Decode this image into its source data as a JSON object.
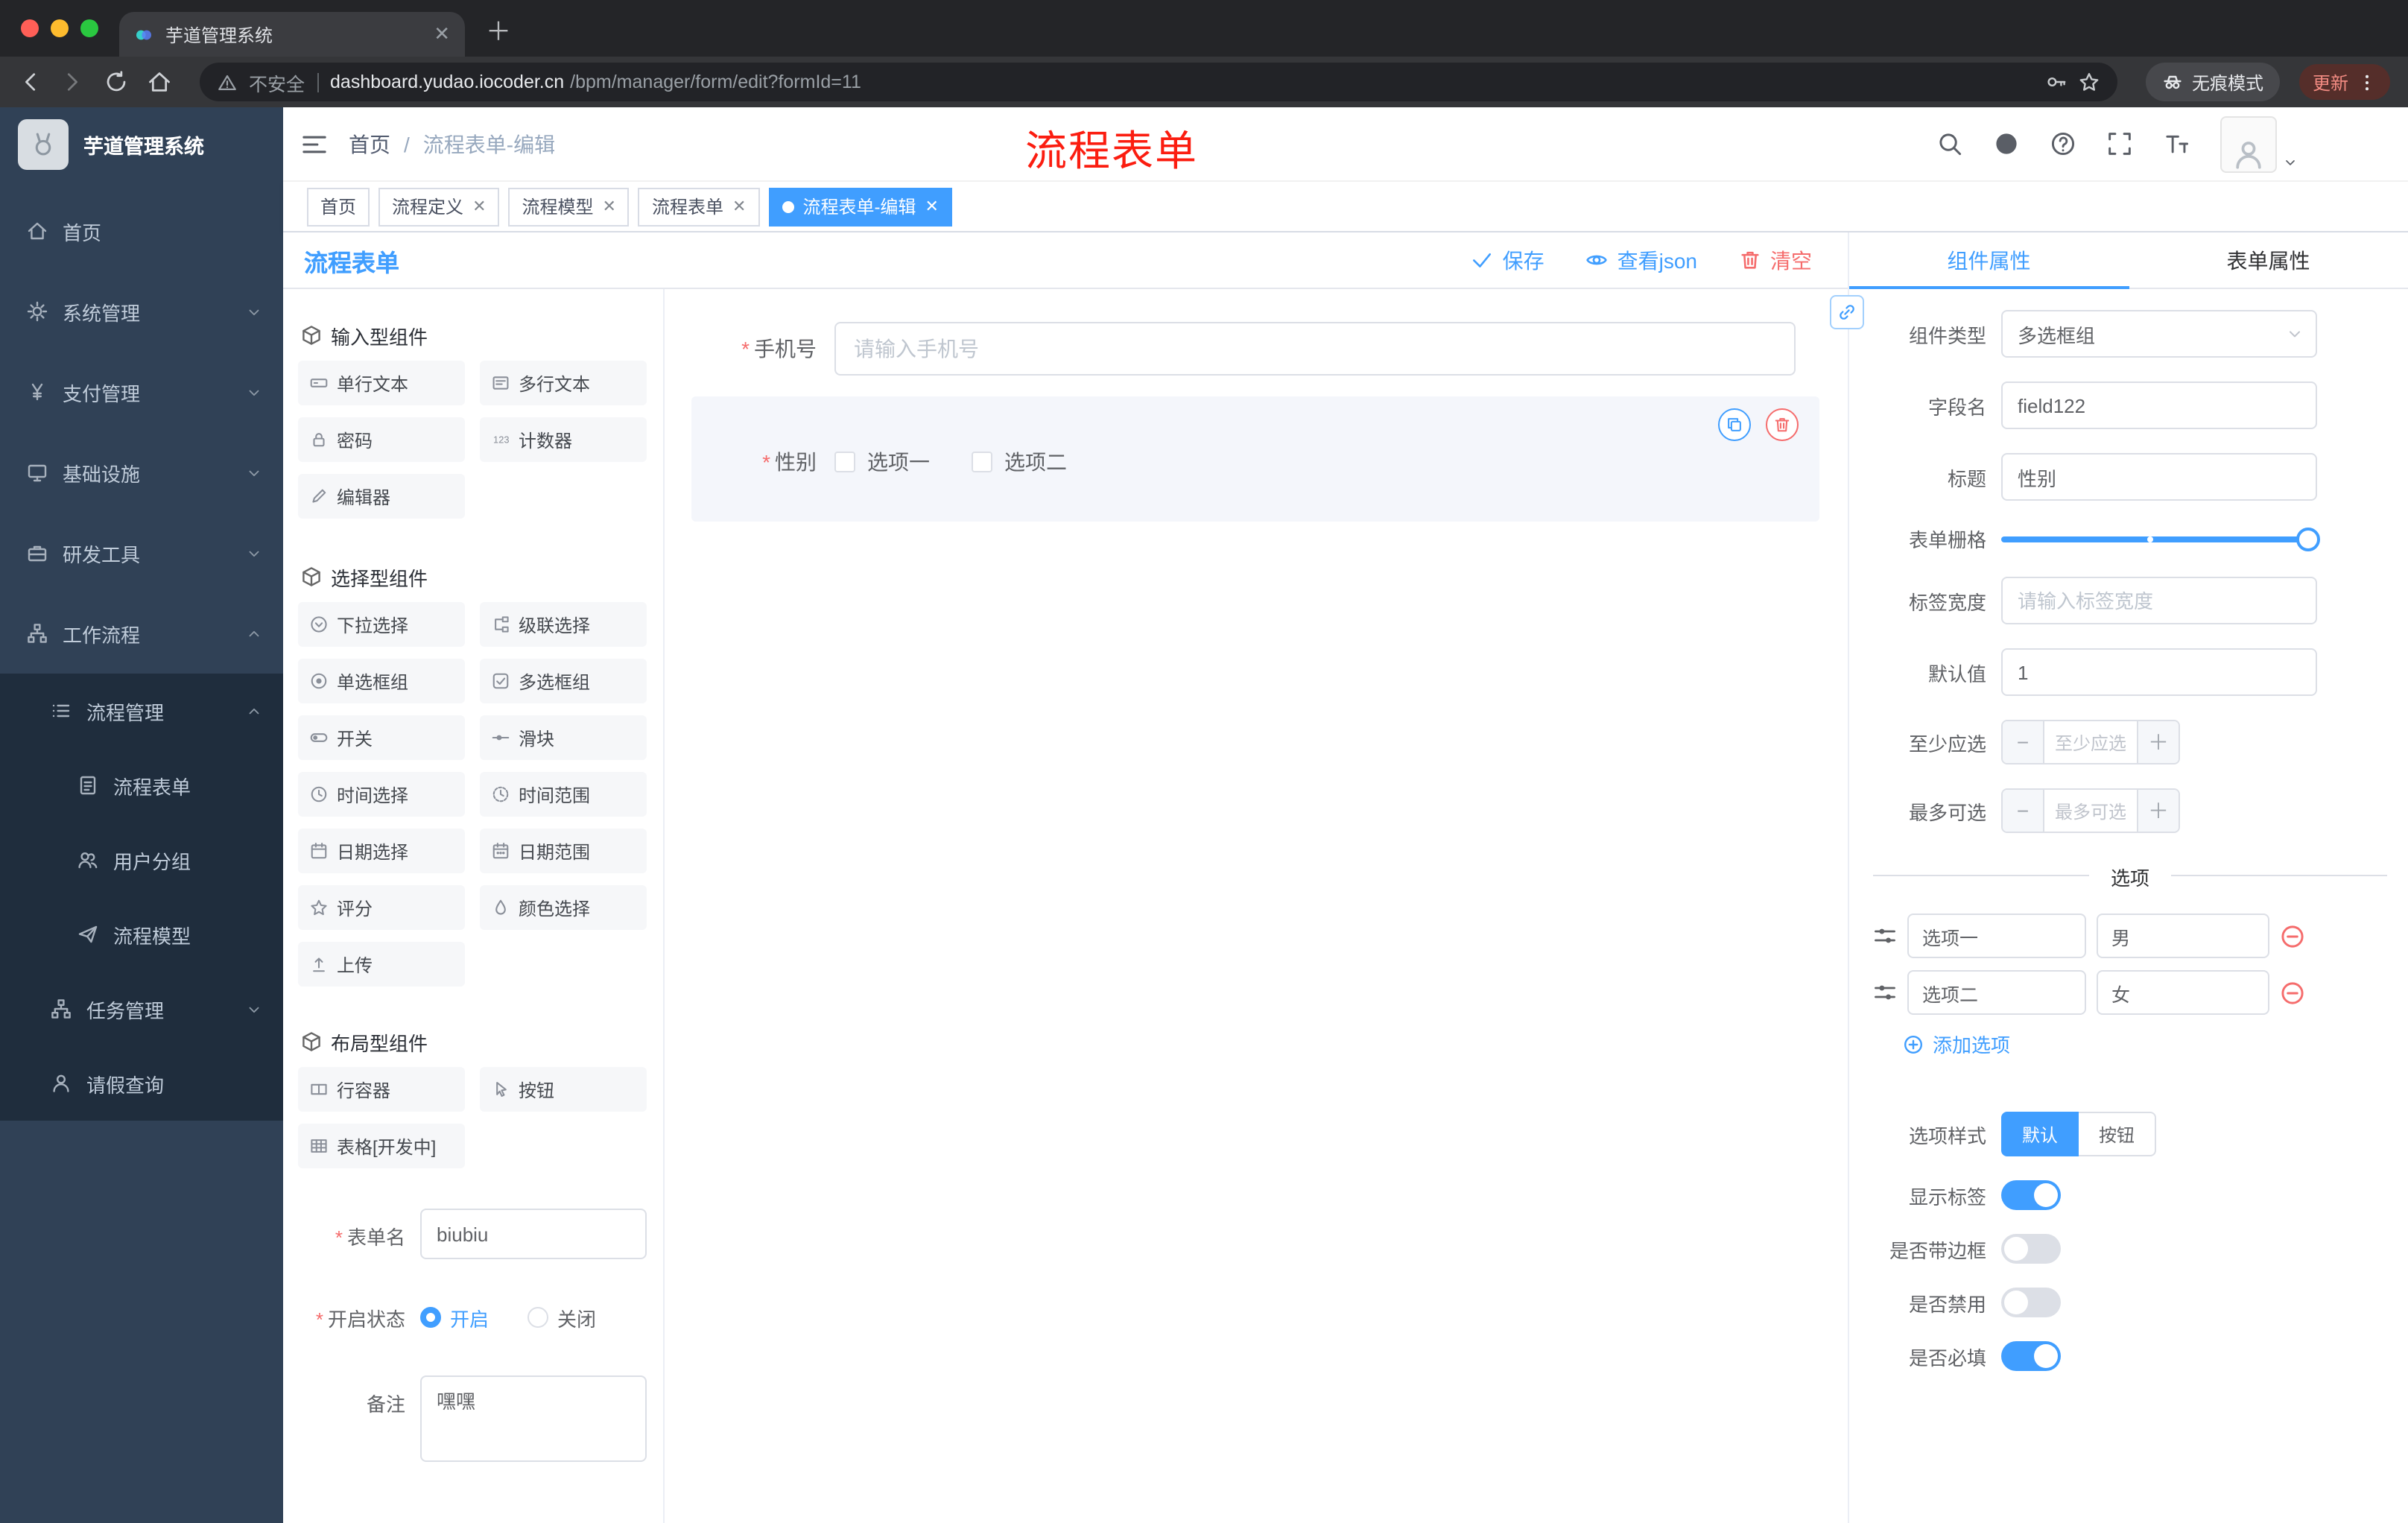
{
  "browser": {
    "tab_title": "芋道管理系统",
    "security_label": "不安全",
    "url_domain": "dashboard.yudao.iocoder.cn",
    "url_path": "/bpm/manager/form/edit?formId=11",
    "incognito_label": "无痕模式",
    "update_label": "更新"
  },
  "annotation": {
    "text": "流程表单"
  },
  "colors": {
    "accent": "#409eff",
    "danger": "#f56c6c",
    "sidebar_bg": "#304156",
    "sidebar_sub_bg": "#1f2d3d"
  },
  "sidebar": {
    "logo_title": "芋道管理系统",
    "menu": [
      {
        "label": "首页",
        "icon": "home-icon"
      },
      {
        "label": "系统管理",
        "icon": "gear-icon"
      },
      {
        "label": "支付管理",
        "icon": "yen-icon"
      },
      {
        "label": "基础设施",
        "icon": "infra-icon"
      },
      {
        "label": "研发工具",
        "icon": "tools-icon"
      },
      {
        "label": "工作流程",
        "icon": "workflow-icon"
      },
      {
        "label": "流程管理",
        "icon": "list-icon"
      },
      {
        "label": "流程表单",
        "icon": "document-icon"
      },
      {
        "label": "用户分组",
        "icon": "users-icon"
      },
      {
        "label": "流程模型",
        "icon": "paper-plane-icon"
      },
      {
        "label": "任务管理",
        "icon": "tree-icon"
      },
      {
        "label": "请假查询",
        "icon": "person-icon"
      }
    ]
  },
  "header": {
    "breadcrumb_home": "首页",
    "breadcrumb_sep": "/",
    "breadcrumb_current": "流程表单-编辑"
  },
  "tags": [
    {
      "label": "首页"
    },
    {
      "label": "流程定义"
    },
    {
      "label": "流程模型"
    },
    {
      "label": "流程表单"
    },
    {
      "label": "流程表单-编辑"
    }
  ],
  "palette": {
    "panel_title": "流程表单",
    "sections": [
      {
        "title": "输入型组件"
      },
      {
        "title": "选择型组件"
      },
      {
        "title": "布局型组件"
      }
    ],
    "chips": {
      "input": [
        "单行文本",
        "多行文本",
        "密码",
        "计数器",
        "编辑器"
      ],
      "select": [
        "下拉选择",
        "级联选择",
        "单选框组",
        "多选框组",
        "开关",
        "滑块",
        "时间选择",
        "时间范围",
        "日期选择",
        "日期范围",
        "评分",
        "颜色选择",
        "上传"
      ],
      "layout": [
        "行容器",
        "按钮",
        "表格[开发中]"
      ]
    },
    "form_meta": {
      "name_label": "表单名",
      "name_value": "biubiu",
      "status_label": "开启状态",
      "status_on": "开启",
      "status_off": "关闭",
      "remark_label": "备注",
      "remark_value": "嘿嘿"
    }
  },
  "canvas": {
    "save": "保存",
    "view_json": "查看json",
    "clear": "清空",
    "phone_label": "手机号",
    "phone_placeholder": "请输入手机号",
    "gender_label": "性别",
    "gender_opt1": "选项一",
    "gender_opt2": "选项二"
  },
  "props": {
    "tab_component": "组件属性",
    "tab_form": "表单属性",
    "type_label": "组件类型",
    "type_value": "多选框组",
    "field_label": "字段名",
    "field_value": "field122",
    "title_label": "标题",
    "title_value": "性别",
    "grid_label": "表单栅格",
    "label_width_label": "标签宽度",
    "label_width_placeholder": "请输入标签宽度",
    "default_label": "默认值",
    "default_value": "1",
    "min_label": "至少应选",
    "min_placeholder": "至少应选",
    "max_label": "最多可选",
    "max_placeholder": "最多可选",
    "divider": "选项",
    "options": [
      {
        "label": "选项一",
        "value": "男"
      },
      {
        "label": "选项二",
        "value": "女"
      }
    ],
    "add_option": "添加选项",
    "style_label": "选项样式",
    "style_default": "默认",
    "style_button": "按钮",
    "toggle_show_label": "显示标签",
    "toggle_border": "是否带边框",
    "toggle_disabled": "是否禁用",
    "toggle_required": "是否必填"
  }
}
